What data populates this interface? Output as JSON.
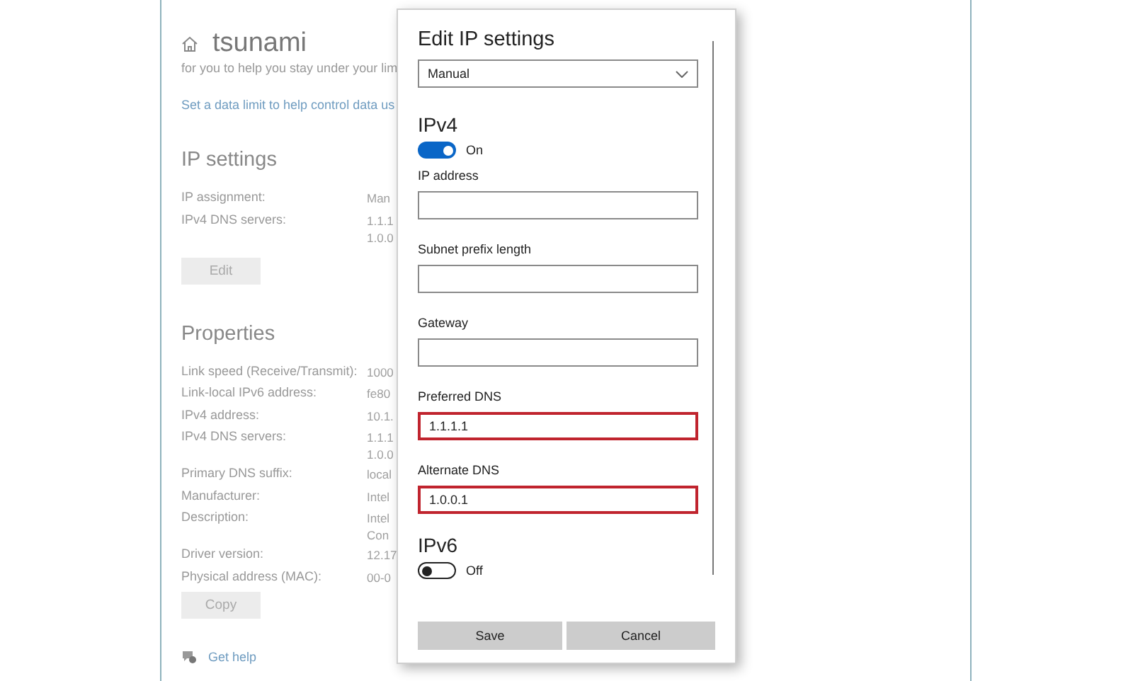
{
  "page_title": "tsunami",
  "intro_text": "for you to help you stay under your lim",
  "data_limit_link": "Set a data limit to help control data us",
  "ip_settings": {
    "heading": "IP settings",
    "rows": [
      {
        "label": "IP assignment:",
        "value_lines": [
          "Man"
        ]
      },
      {
        "label": "IPv4 DNS servers:",
        "value_lines": [
          "1.1.1",
          "1.0.0"
        ]
      }
    ],
    "edit_button": "Edit"
  },
  "properties": {
    "heading": "Properties",
    "rows": [
      {
        "label": "Link speed (Receive/Transmit):",
        "value_lines": [
          "1000"
        ]
      },
      {
        "label": "Link-local IPv6 address:",
        "value_lines": [
          "fe80"
        ]
      },
      {
        "label": "IPv4 address:",
        "value_lines": [
          "10.1."
        ]
      },
      {
        "label": "IPv4 DNS servers:",
        "value_lines": [
          "1.1.1",
          "1.0.0"
        ]
      },
      {
        "label": "Primary DNS suffix:",
        "value_lines": [
          "local"
        ]
      },
      {
        "label": "Manufacturer:",
        "value_lines": [
          "Intel"
        ]
      },
      {
        "label": "Description:",
        "value_lines": [
          "Intel",
          "Con"
        ]
      },
      {
        "label": "Driver version:",
        "value_lines": [
          "12.17"
        ]
      },
      {
        "label": "Physical address (MAC):",
        "value_lines": [
          "00-0"
        ]
      }
    ],
    "copy_button": "Copy"
  },
  "help_link": "Get help",
  "dialog": {
    "title": "Edit IP settings",
    "mode_dropdown": {
      "value": "Manual"
    },
    "sections": [
      {
        "heading": "IPv4",
        "toggle": {
          "on": true,
          "label": "On"
        },
        "fields": [
          {
            "label": "IP address",
            "highlighted": false
          },
          {
            "label": "Subnet prefix length",
            "highlighted": false
          },
          {
            "label": "Gateway",
            "highlighted": false
          },
          {
            "label": "Preferred DNS",
            "value": "1.1.1.1",
            "highlighted": true
          },
          {
            "label": "Alternate DNS",
            "value": "1.0.0.1",
            "highlighted": true
          }
        ]
      },
      {
        "heading": "IPv6",
        "toggle": {
          "on": false,
          "label": "Off"
        }
      }
    ],
    "buttons": [
      "Save",
      "Cancel"
    ]
  }
}
